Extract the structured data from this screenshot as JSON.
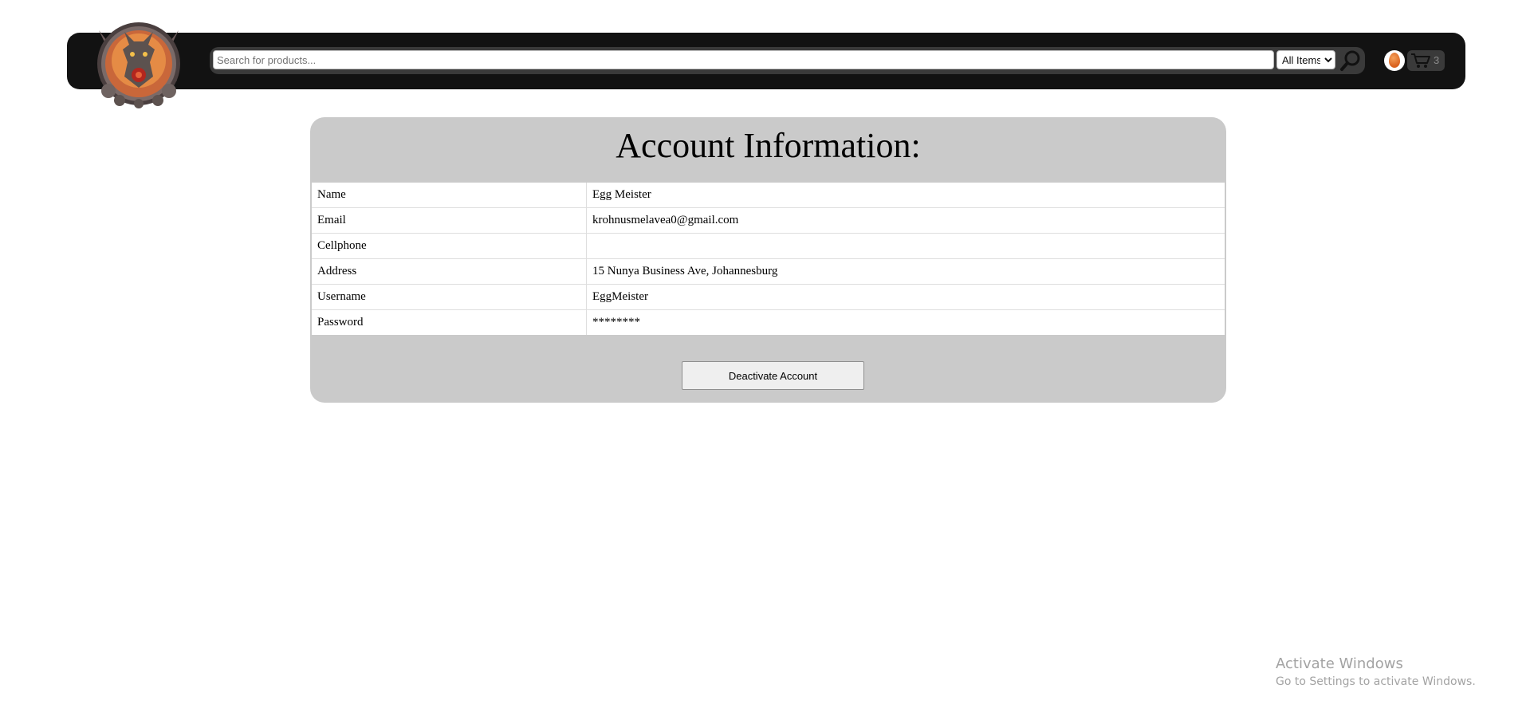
{
  "header": {
    "search": {
      "placeholder": "Search for products...",
      "value": ""
    },
    "category": {
      "selected": "All Items"
    },
    "cart": {
      "count": "3"
    }
  },
  "account": {
    "title": "Account Information:",
    "fields": [
      {
        "label": "Name",
        "value": "Egg Meister"
      },
      {
        "label": "Email",
        "value": "krohnusmelavea0@gmail.com"
      },
      {
        "label": "Cellphone",
        "value": ""
      },
      {
        "label": "Address",
        "value": "15 Nunya Business Ave, Johannesburg"
      },
      {
        "label": "Username",
        "value": "EggMeister"
      },
      {
        "label": "Password",
        "value": "********"
      }
    ],
    "deactivate_label": "Deactivate Account"
  },
  "watermark": {
    "title": "Activate Windows",
    "subtitle": "Go to Settings to activate Windows."
  },
  "colors": {
    "navbar": "#121212",
    "panel": "#cacaca",
    "accent_egg": "#d9621f"
  },
  "icons": {
    "logo": "dragon-crest-logo",
    "search": "magnifier-icon",
    "avatar": "egg-avatar-icon",
    "cart": "shopping-cart-icon"
  }
}
